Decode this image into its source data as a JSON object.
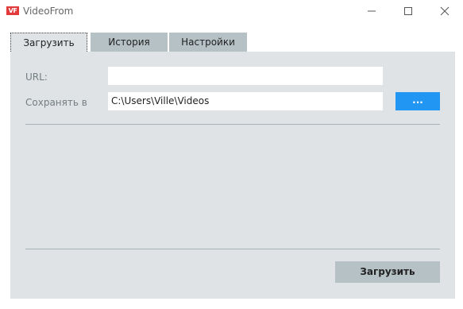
{
  "window": {
    "title": "VideoFrom",
    "icon_text": "VF",
    "icon_color": "#e2393b"
  },
  "tabs": [
    {
      "label": "Загрузить",
      "active": true
    },
    {
      "label": "История",
      "active": false
    },
    {
      "label": "Настройки",
      "active": false
    }
  ],
  "form": {
    "url_label": "URL:",
    "url_value": "",
    "save_label": "Сохранять в",
    "save_path": "C:\\Users\\Ville\\Videos",
    "browse_label": "..."
  },
  "actions": {
    "download_label": "Загрузить"
  },
  "colors": {
    "accent": "#2196f3",
    "panel": "#dfe3e5",
    "tab_inactive": "#b6c1c6"
  }
}
